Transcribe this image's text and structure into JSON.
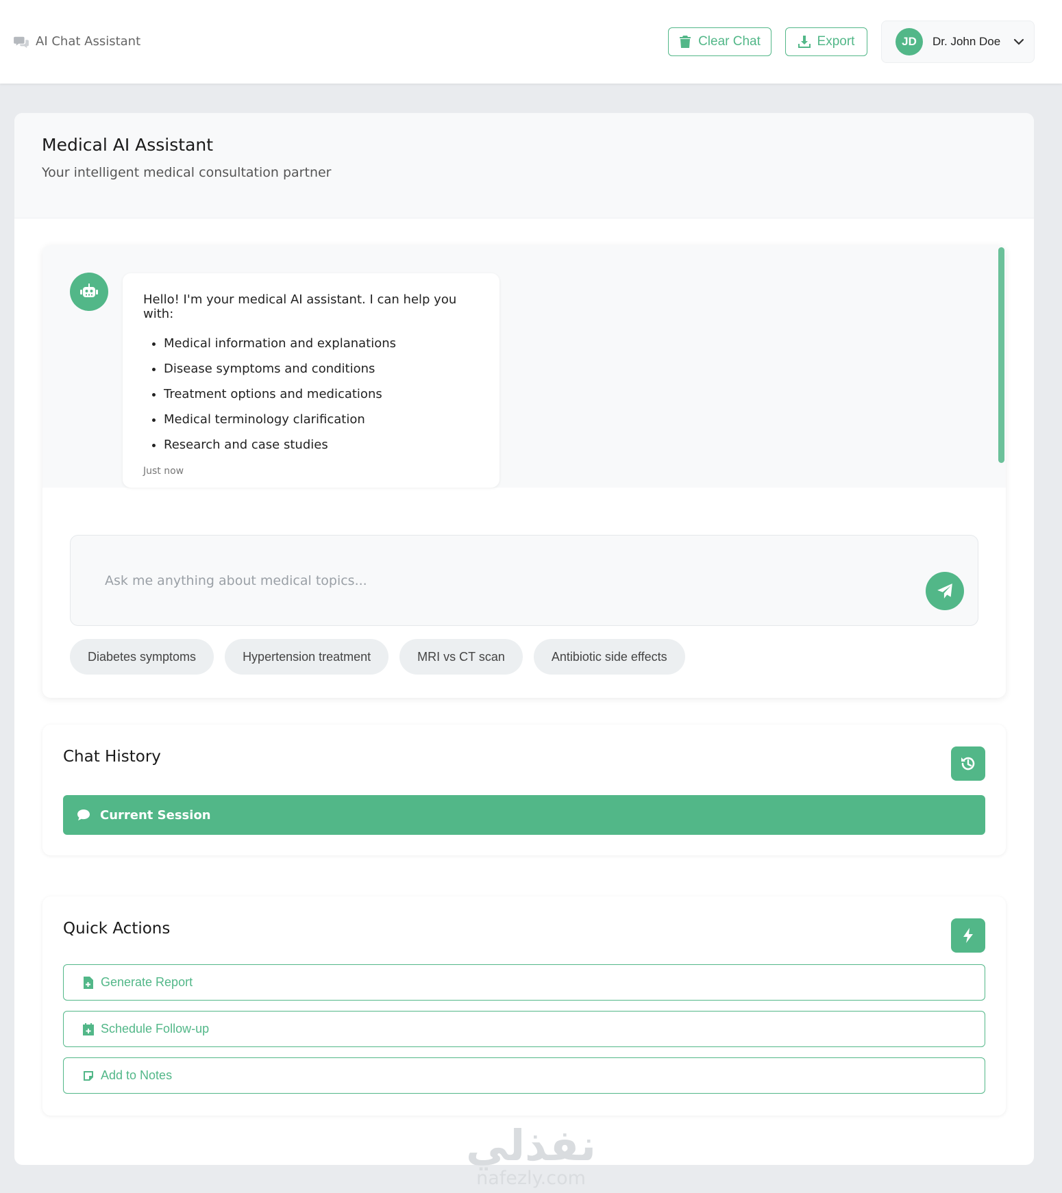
{
  "header": {
    "app_title": "AI Chat Assistant",
    "clear_label": "Clear Chat",
    "export_label": "Export",
    "user_initials": "JD",
    "user_name": "Dr. John Doe"
  },
  "page": {
    "title": "Medical AI Assistant",
    "subtitle": "Your intelligent medical consultation partner"
  },
  "chat": {
    "message": {
      "intro": "Hello! I'm your medical AI assistant. I can help you with:",
      "items": [
        "Medical information and explanations",
        "Disease symptoms and conditions",
        "Treatment options and medications",
        "Medical terminology clarification",
        "Research and case studies"
      ],
      "time": "Just now"
    },
    "input_placeholder": "Ask me anything about medical topics...",
    "suggestions": [
      "Diabetes symptoms",
      "Hypertension treatment",
      "MRI vs CT scan",
      "Antibiotic side effects"
    ]
  },
  "history": {
    "title": "Chat History",
    "current_session": "Current Session"
  },
  "actions": {
    "title": "Quick Actions",
    "items": [
      "Generate Report",
      "Schedule Follow-up",
      "Add to Notes"
    ]
  },
  "watermark": {
    "arabic": "نفذلي",
    "latin": "nafezly.com"
  },
  "colors": {
    "accent": "#52b788",
    "background": "#e9ebee",
    "panel": "#f8f9fa"
  },
  "icons": {
    "brand": "comments-icon",
    "clear": "trash-icon",
    "export": "download-icon",
    "user_menu": "chevron-down-icon",
    "bot": "robot-icon",
    "send": "paper-plane-icon",
    "history": "history-icon",
    "session": "comment-icon",
    "actions": "bolt-icon",
    "report": "file-medical-icon",
    "schedule": "calendar-plus-icon",
    "notes": "sticky-note-icon"
  }
}
